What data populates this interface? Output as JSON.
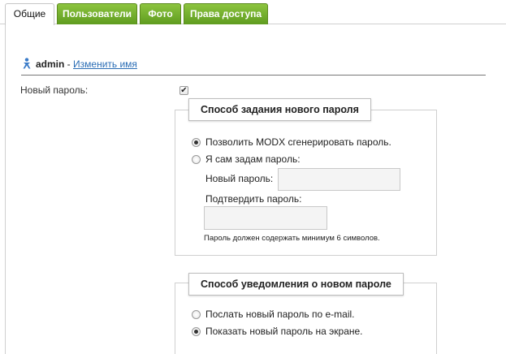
{
  "tabs": [
    {
      "label": "Общие",
      "active": true
    },
    {
      "label": "Пользователи",
      "active": false
    },
    {
      "label": "Фото",
      "active": false
    },
    {
      "label": "Права доступа",
      "active": false
    }
  ],
  "user": {
    "name": "admin",
    "separator": " - ",
    "rename_link": "Изменить имя"
  },
  "new_password": {
    "label": "Новый пароль:",
    "checked": true
  },
  "password_method": {
    "legend": "Способ задания нового пароля",
    "option_generate": "Позволить MODX сгенерировать пароль.",
    "option_manual": "Я сам задам пароль:",
    "selected": "generate",
    "field_new_label": "Новый пароль:",
    "field_confirm_label": "Подтвердить пароль:",
    "hint": "Пароль должен содержать минимум 6 символов."
  },
  "notify_method": {
    "legend": "Способ уведомления о новом пароле",
    "option_email": "Послать новый пароль по e-mail.",
    "option_screen": "Показать новый пароль на экране.",
    "selected": "screen"
  },
  "colors": {
    "tab_green_top": "#8cc43f",
    "tab_green_bottom": "#5f9c1f",
    "link": "#2a6db5"
  }
}
